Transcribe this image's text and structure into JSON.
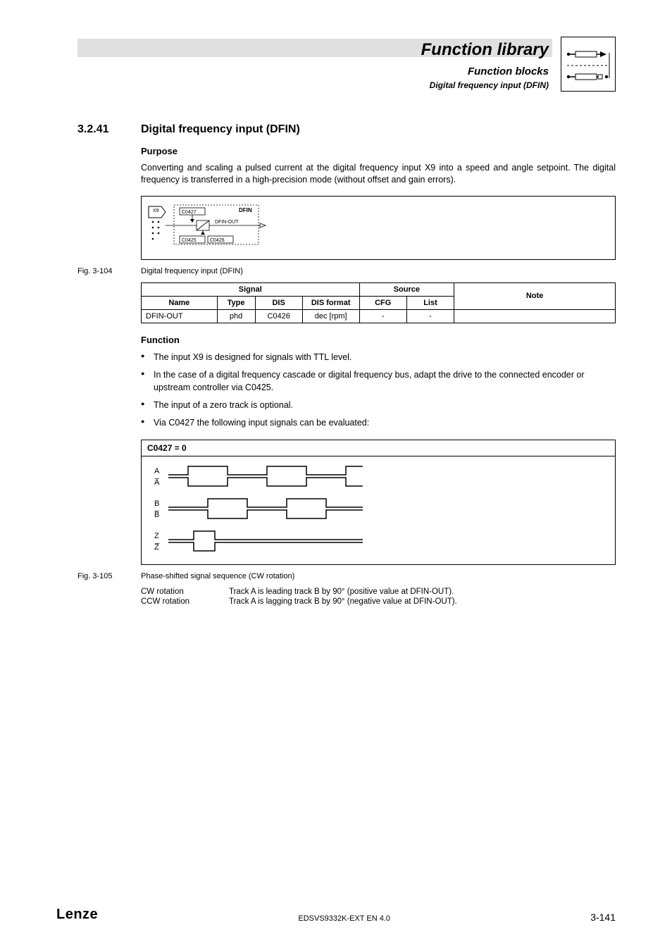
{
  "header": {
    "title": "Function library",
    "sub1": "Function blocks",
    "sub2": "Digital frequency input (DFIN)"
  },
  "section": {
    "num": "3.2.41",
    "title": "Digital frequency input (DFIN)"
  },
  "purpose": {
    "heading": "Purpose",
    "text": "Converting and scaling a pulsed current at the digital frequency input X9 into a speed and angle setpoint. The digital frequency is transferred in a high-precision mode (without offset and gain errors)."
  },
  "diagram": {
    "x9": "X9",
    "c0427": "C0427",
    "dfin": "DFIN",
    "dfin_out": "DFIN-OUT",
    "c0425": "C0425",
    "c0426": "C0426"
  },
  "fig104": {
    "label": "Fig. 3-104",
    "caption": "Digital frequency input (DFIN)"
  },
  "chart_data": {
    "type": "table",
    "headers": {
      "signal": "Signal",
      "source": "Source",
      "note": "Note",
      "name": "Name",
      "type": "Type",
      "dis": "DIS",
      "dis_format": "DIS format",
      "cfg": "CFG",
      "list": "List"
    },
    "rows": [
      {
        "name": "DFIN-OUT",
        "type": "phd",
        "dis": "C0426",
        "dis_format": "dec [rpm]",
        "cfg": "-",
        "list": "-",
        "note": ""
      }
    ]
  },
  "function": {
    "heading": "Function",
    "items": [
      "The input X9 is designed for signals with TTL level.",
      "In the case of a digital frequency cascade or digital frequency bus, adapt the drive to the connected encoder or upstream controller via C0425.",
      "The input of a zero track is optional.",
      "Via C0427 the following input signals can be evaluated:"
    ]
  },
  "wave": {
    "title": "C0427 = 0",
    "tracks": [
      "A",
      "A̅",
      "B",
      "B̅",
      "Z",
      "Z̅"
    ]
  },
  "fig105": {
    "label": "Fig. 3-105",
    "caption": "Phase-shifted signal sequence (CW rotation)"
  },
  "rotation": {
    "cw_label": "CW rotation",
    "cw_text": "Track A is leading track B by 90° (positive value at DFIN-OUT).",
    "ccw_label": "CCW rotation",
    "ccw_text": "Track A is lagging track B by 90° (negative value at DFIN-OUT)."
  },
  "footer": {
    "brand": "Lenze",
    "doc": "EDSVS9332K-EXT EN 4.0",
    "page": "3-141"
  }
}
